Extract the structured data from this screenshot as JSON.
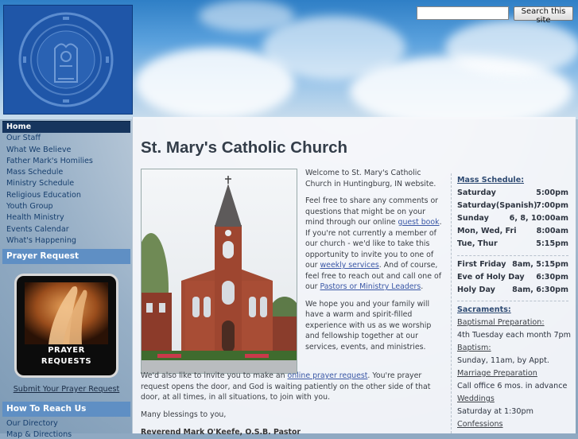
{
  "search": {
    "placeholder": "",
    "button_label": "Search this site"
  },
  "nav": {
    "items": [
      "Home",
      "Our Staff",
      "What We Believe",
      "Father Mark's Homilies",
      "Mass Schedule",
      "Ministry Schedule",
      "Religious Education",
      "Youth Group",
      "Health Ministry",
      "Events Calendar",
      "What's Happening"
    ],
    "active": "Home"
  },
  "sidebar": {
    "prayer_heading": "Prayer Request",
    "prayer_image_line1": "PRAYER",
    "prayer_image_line2": "REQUESTS",
    "prayer_link": "Submit Your Prayer Request",
    "reach_heading": "How To Reach Us",
    "reach_items": [
      "Our Directory",
      "Map & Directions"
    ]
  },
  "main": {
    "title": "St. Mary's Catholic Church",
    "welcome": "Welcome to St. Mary's Catholic Church in Huntingburg, IN website.",
    "p2_a": "Feel free to share any comments or questions that might be on your mind through our online ",
    "p2_link1": "guest book",
    "p2_b": ". If you're not currently a member of our church - we'd like to take this opportunity to invite you to one of our ",
    "p2_link2": "weekly services",
    "p2_c": ". And of course, feel free to reach out and call one of our ",
    "p2_link3": "Pastors or Ministry Leaders",
    "p2_d": ".",
    "p3": "We hope you and your family will have a warm and spirit-filled experience with us as we worship and fellowship together at our services, events, and ministries.",
    "p4_a": "We'd also like to invite you to make an ",
    "p4_link": "online prayer request",
    "p4_b": ". You're prayer request opens the door, and God is waiting patiently on the other side of that door, at all times, in all situations, to join with you.",
    "closing": "Many blessings to you,",
    "signature": "Reverend Mark O'Keefe, O.S.B. Pastor"
  },
  "schedule": {
    "title": "Mass Schedule:",
    "rows": [
      {
        "day": "Saturday",
        "time": "5:00pm"
      },
      {
        "day": "Saturday(Spanish)",
        "time": "7:00pm"
      },
      {
        "day": "Sunday",
        "time": "6, 8, 10:00am"
      },
      {
        "day": "Mon, Wed, Fri",
        "time": "8:00am"
      },
      {
        "day": "Tue, Thur",
        "time": "5:15pm"
      }
    ],
    "rows2": [
      {
        "day": "First Friday",
        "time": "8am, 5:15pm"
      },
      {
        "day": "Eve of Holy Day",
        "time": "6:30pm"
      },
      {
        "day": "Holy Day",
        "time": "8am, 6:30pm"
      }
    ],
    "sacraments_title": "Sacraments:",
    "sacraments": [
      {
        "name": "Baptismal Preparation:",
        "detail": "4th Tuesday each month 7pm"
      },
      {
        "name": "Baptism:",
        "detail": "Sunday, 11am, by Appt."
      },
      {
        "name": "Marriage Preparation",
        "detail": "Call office 6 mos. in advance"
      },
      {
        "name": "Weddings",
        "detail": "Saturday at 1:30pm"
      },
      {
        "name": "Confessions",
        "detail": ""
      }
    ]
  },
  "colors": {
    "nav_active": "#16355e",
    "heading_bar": "#5f8fc4",
    "link": "#3a57a6",
    "seal_blue": "#1f56a8"
  }
}
